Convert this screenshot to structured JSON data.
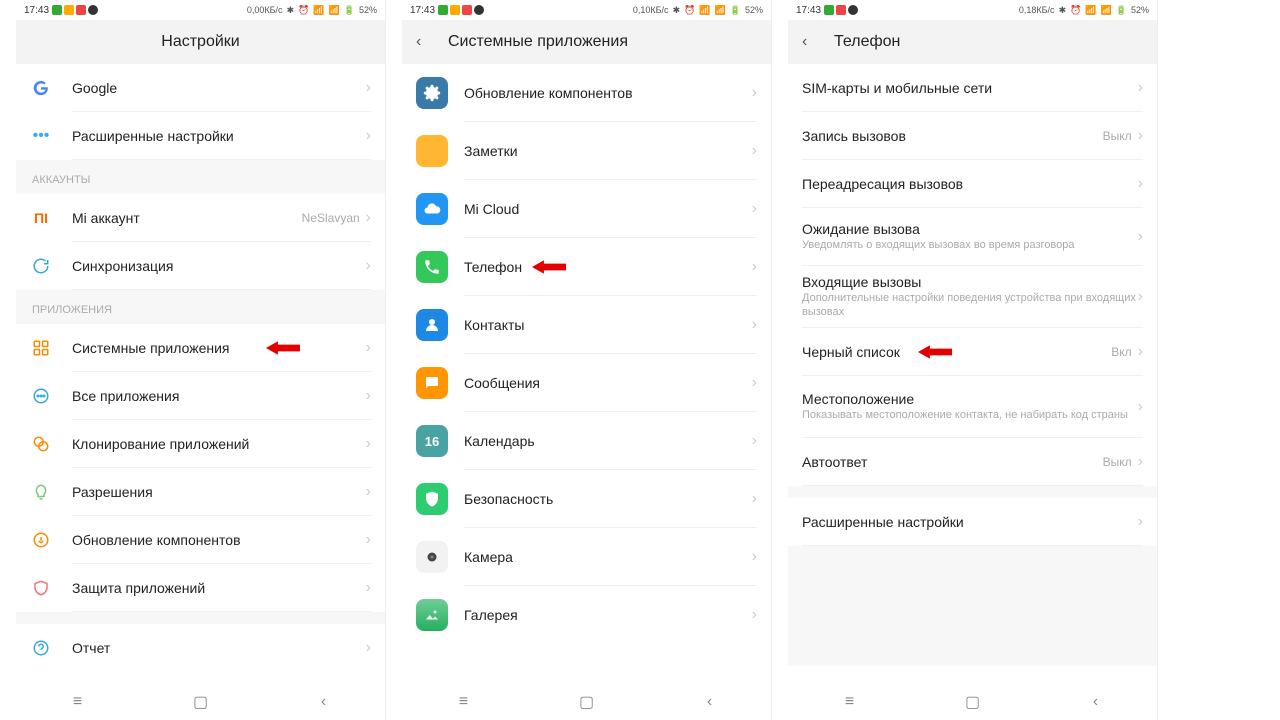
{
  "status": {
    "time": "17:43",
    "battery": "52%",
    "screens": [
      "0,00КБ/с",
      "0,10КБ/с",
      "0,18КБ/с"
    ]
  },
  "screen1": {
    "title": "Настройки",
    "rows_top": [
      {
        "label": "Google"
      },
      {
        "label": "Расширенные настройки"
      }
    ],
    "section_accounts": "АККАУНТЫ",
    "rows_accounts": [
      {
        "label": "Mi аккаунт",
        "value": "NeSlavyan"
      },
      {
        "label": "Синхронизация"
      }
    ],
    "section_apps": "ПРИЛОЖЕНИЯ",
    "rows_apps": [
      {
        "label": "Системные приложения"
      },
      {
        "label": "Все приложения"
      },
      {
        "label": "Клонирование приложений"
      },
      {
        "label": "Разрешения"
      },
      {
        "label": "Обновление компонентов"
      },
      {
        "label": "Защита приложений"
      },
      {
        "label": "Отчет"
      }
    ]
  },
  "screen2": {
    "title": "Системные приложения",
    "rows": [
      {
        "label": "Обновление компонентов"
      },
      {
        "label": "Заметки"
      },
      {
        "label": "Mi Cloud"
      },
      {
        "label": "Телефон"
      },
      {
        "label": "Контакты"
      },
      {
        "label": "Сообщения"
      },
      {
        "label": "Календарь"
      },
      {
        "label": "Безопасность"
      },
      {
        "label": "Камера"
      },
      {
        "label": "Галерея"
      }
    ]
  },
  "screen3": {
    "title": "Телефон",
    "rows": [
      {
        "label": "SIM-карты и мобильные сети"
      },
      {
        "label": "Запись вызовов",
        "value": "Выкл"
      },
      {
        "label": "Переадресация вызовов"
      },
      {
        "label": "Ожидание вызова",
        "sub": "Уведомлять о входящих вызовах во время разговора"
      },
      {
        "label": "Входящие вызовы",
        "sub": "Дополнительные настройки поведения устройства при входящих вызовах"
      },
      {
        "label": "Черный список",
        "value": "Вкл"
      },
      {
        "label": "Местоположение",
        "sub": "Показывать местоположение контакта, не набирать код страны"
      },
      {
        "label": "Автоответ",
        "value": "Выкл"
      },
      {
        "label": "Расширенные настройки"
      }
    ]
  }
}
